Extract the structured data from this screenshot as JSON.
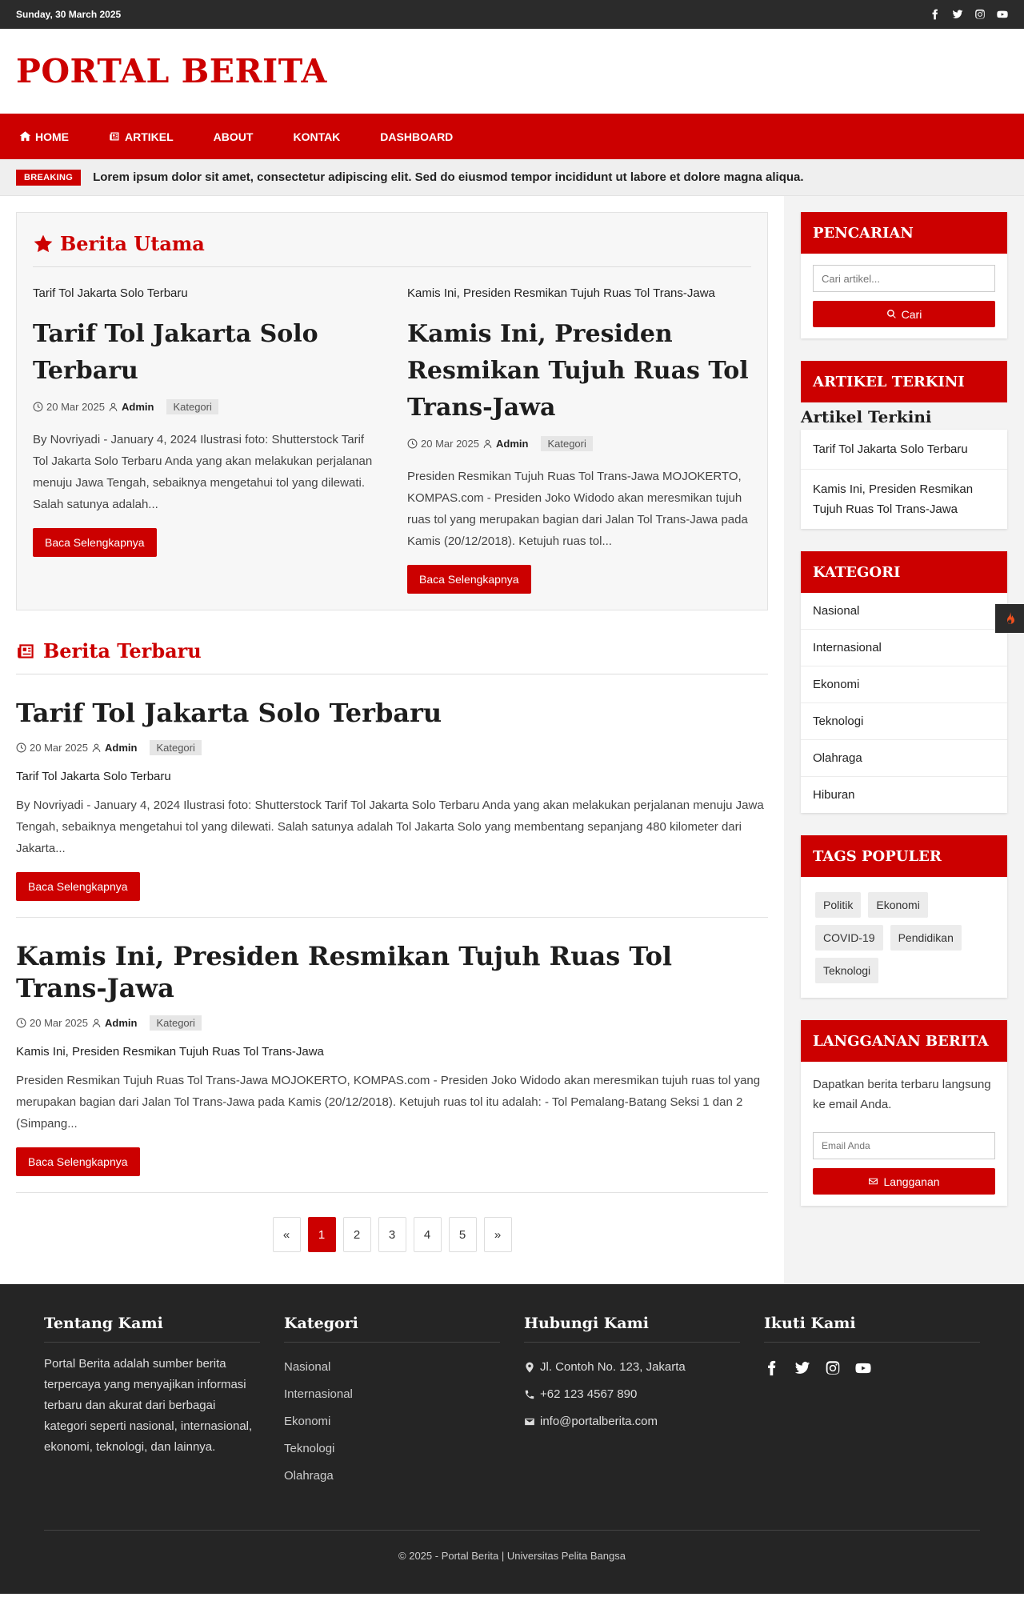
{
  "topbar": {
    "date": "Sunday, 30 March 2025",
    "socials": [
      "facebook-icon",
      "twitter-icon",
      "instagram-icon",
      "youtube-icon"
    ]
  },
  "brand": {
    "name": "PORTAL BERITA",
    "color": "#cc0000"
  },
  "nav": [
    {
      "label": "HOME",
      "icon": "home-icon"
    },
    {
      "label": "ARTIKEL",
      "icon": "newspaper-icon"
    },
    {
      "label": "ABOUT"
    },
    {
      "label": "KONTAK"
    },
    {
      "label": "DASHBOARD"
    }
  ],
  "breaking": {
    "label": "BREAKING",
    "text": "Lorem ipsum dolor sit amet, consectetur adipiscing elit. Sed do eiusmod tempor incididunt ut labore et dolore magna aliqua."
  },
  "featured": {
    "title": "Berita Utama",
    "articles": [
      {
        "kicker": "Tarif Tol Jakarta Solo Terbaru",
        "title": "Tarif Tol Jakarta Solo Terbaru",
        "date": "20 Mar 2025",
        "author": "Admin",
        "category": "Kategori",
        "excerpt": "By Novriyadi - January 4, 2024 Ilustrasi foto: Shutterstock Tarif Tol Jakarta Solo Terbaru Anda yang akan melakukan perjalanan menuju Jawa Tengah, sebaiknya mengetahui tol yang dilewati. Salah satunya adalah...",
        "button": "Baca Selengkapnya"
      },
      {
        "kicker": "Kamis Ini, Presiden Resmikan Tujuh Ruas Tol Trans-Jawa",
        "title": "Kamis Ini, Presiden Resmikan Tujuh Ruas Tol Trans-Jawa",
        "date": "20 Mar 2025",
        "author": "Admin",
        "category": "Kategori",
        "excerpt": "Presiden Resmikan Tujuh Ruas Tol Trans-Jawa MOJOKERTO, KOMPAS.com - Presiden Joko Widodo akan meresmikan tujuh ruas tol yang merupakan bagian dari Jalan Tol Trans-Jawa pada Kamis (20/12/2018). Ketujuh ruas tol...",
        "button": "Baca Selengkapnya"
      }
    ]
  },
  "latest": {
    "title": "Berita Terbaru",
    "articles": [
      {
        "title": "Tarif Tol Jakarta Solo Terbaru",
        "date": "20 Mar 2025",
        "author": "Admin",
        "category": "Kategori",
        "kicker": "Tarif Tol Jakarta Solo Terbaru",
        "excerpt": "By Novriyadi - January 4, 2024 Ilustrasi foto: Shutterstock Tarif Tol Jakarta Solo Terbaru Anda yang akan melakukan perjalanan menuju Jawa Tengah, sebaiknya mengetahui tol yang dilewati. Salah satunya adalah Tol Jakarta Solo yang membentang sepanjang 480 kilometer dari Jakarta...",
        "button": "Baca Selengkapnya"
      },
      {
        "title": "Kamis Ini, Presiden Resmikan Tujuh Ruas Tol Trans-Jawa",
        "date": "20 Mar 2025",
        "author": "Admin",
        "category": "Kategori",
        "kicker": "Kamis Ini, Presiden Resmikan Tujuh Ruas Tol Trans-Jawa",
        "excerpt": "Presiden Resmikan Tujuh Ruas Tol Trans-Jawa MOJOKERTO, KOMPAS.com - Presiden Joko Widodo akan meresmikan tujuh ruas tol yang merupakan bagian dari Jalan Tol Trans-Jawa pada Kamis (20/12/2018). Ketujuh ruas tol itu adalah: - Tol Pemalang-Batang Seksi 1 dan 2 (Simpang...",
        "button": "Baca Selengkapnya"
      }
    ]
  },
  "pagination": {
    "prev": "«",
    "pages": [
      "1",
      "2",
      "3",
      "4",
      "5"
    ],
    "active": "1",
    "next": "»"
  },
  "sidebar": {
    "search": {
      "title": "PENCARIAN",
      "placeholder": "Cari artikel...",
      "button": "Cari"
    },
    "recent": {
      "title": "ARTIKEL TERKINI",
      "subtitle": "Artikel Terkini",
      "items": [
        "Tarif Tol Jakarta Solo Terbaru",
        "Kamis Ini, Presiden Resmikan Tujuh Ruas Tol Trans-Jawa"
      ]
    },
    "categories": {
      "title": "KATEGORI",
      "items": [
        "Nasional",
        "Internasional",
        "Ekonomi",
        "Teknologi",
        "Olahraga",
        "Hiburan"
      ]
    },
    "tags": {
      "title": "TAGS POPULER",
      "items": [
        "Politik",
        "Ekonomi",
        "COVID-19",
        "Pendidikan",
        "Teknologi"
      ]
    },
    "newsletter": {
      "title": "LANGGANAN BERITA",
      "text": "Dapatkan berita terbaru langsung ke email Anda.",
      "placeholder": "Email Anda",
      "button": "Langganan"
    }
  },
  "footer": {
    "about": {
      "title": "Tentang Kami",
      "text": "Portal Berita adalah sumber berita terpercaya yang menyajikan informasi terbaru dan akurat dari berbagai kategori seperti nasional, internasional, ekonomi, teknologi, dan lainnya."
    },
    "categories": {
      "title": "Kategori",
      "items": [
        "Nasional",
        "Internasional",
        "Ekonomi",
        "Teknologi",
        "Olahraga"
      ]
    },
    "contact": {
      "title": "Hubungi Kami",
      "address": "Jl. Contoh No. 123, Jakarta",
      "phone": "+62 123 4567 890",
      "email": "info@portalberita.com"
    },
    "follow": {
      "title": "Ikuti Kami"
    },
    "copyright": "© 2025 - Portal Berita | Universitas Pelita Bangsa"
  }
}
